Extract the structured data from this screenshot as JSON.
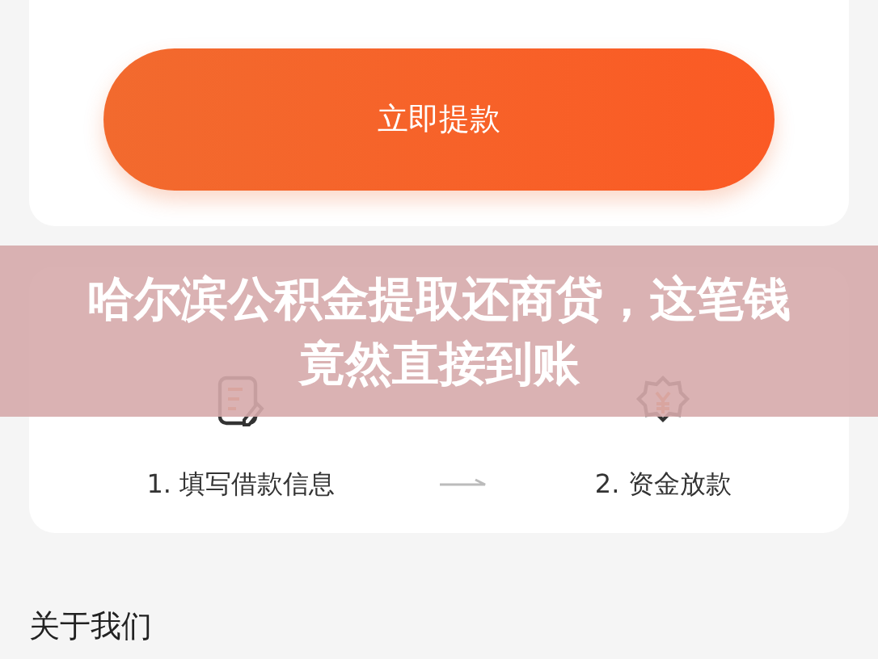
{
  "withdraw_button": {
    "label": "立即提款"
  },
  "banner": {
    "title": "哈尔滨公积金提取还商贷，这笔钱竟然直接到账"
  },
  "steps": [
    {
      "label": "1. 填写借款信息",
      "kind": "form"
    },
    {
      "label": "2. 资金放款",
      "kind": "money"
    }
  ],
  "about": {
    "title": "关于我们"
  }
}
